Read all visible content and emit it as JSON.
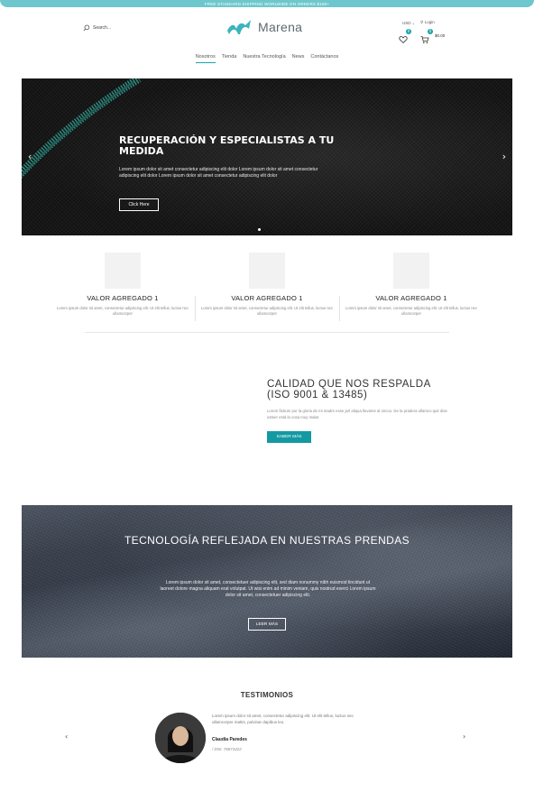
{
  "promo": {
    "text": "FREE STANDARD SHIPPING WORLWIDE ON ORDERS $150+"
  },
  "header": {
    "search_placeholder": "Search...",
    "brand": "Marena",
    "currency": "USD",
    "login": "Login",
    "wishlist_count": "0",
    "cart_count": "0",
    "cart_total": "$0.00"
  },
  "nav": {
    "items": [
      {
        "label": "Nosotros"
      },
      {
        "label": "Tienda"
      },
      {
        "label": "Nuestra Tecnología"
      },
      {
        "label": "News"
      },
      {
        "label": "Contáctanos"
      }
    ]
  },
  "hero": {
    "title": "RECUPERACIÓN Y ESPECIALISTAS A TU MEDIDA",
    "text": "Lorem ipsum dolor sit amet consectetur adipiscing elit dolor Lorem ipsum dolor sit amet consectetur adipiscing elit dolor Lorem ipsum dolor sit amet consectetur adipiscing elit dolor",
    "button": "Click Here",
    "prev": "‹",
    "next": "›"
  },
  "features": [
    {
      "title": "VALOR AGREGADO 1",
      "text": "Lorem ipsum dolor sit amet, consectetur adipiscing elit. Ut elit tellus, luctus nec ullamcorper"
    },
    {
      "title": "VALOR AGREGADO 1",
      "text": "Lorem ipsum dolor sit amet, consectetur adipiscing elit. Ut elit tellus, luctus nec ullamcorper"
    },
    {
      "title": "VALOR AGREGADO 1",
      "text": "Lorem ipsum dolor sit amet, consectetur adipiscing elit. Ut elit tellus, luctus nec ullamcorper"
    }
  ],
  "quality": {
    "title": "CALIDAD QUE NOS RESPALDA (ISO 9001 & 13485)",
    "text": "Lorem fistrum por la gloria de mi madre esse jarl aliqua llevame al sircoo. De la pradera ullamco qué dise usteer está la cosa muy malar.",
    "button": "SABER MÁS"
  },
  "tech": {
    "title": "TECNOLOGÍA REFLEJADA EN NUESTRAS PRENDAS",
    "text": "Lorem ipsum dolor sit amet, consectetuer adipiscing elit, sed diam nonummy nibh euismod tincidunt ut laoreet dolore magna aliquam erat volutpat. Ut wisi enim ad minim veniam, quis nostrud exerci Lorem ipsum dolor sit amet, consectetuer adipiscing elit.",
    "button": "LEER MÁS"
  },
  "testimonials": {
    "title": "TESTIMONIOS",
    "quote": "Lorem ipsum dolor sit amet, consectetur adipiscing elit. Ut elit tellus, luctus nec ullamcorper mattis, pulvinar dapibus leo.",
    "name": "Claudia Paredes",
    "dni": "/ DNI: 76873422",
    "prev": "‹",
    "next": "›"
  },
  "colors": {
    "accent": "#19a3ab",
    "promo_bar": "#6ec7cc"
  }
}
